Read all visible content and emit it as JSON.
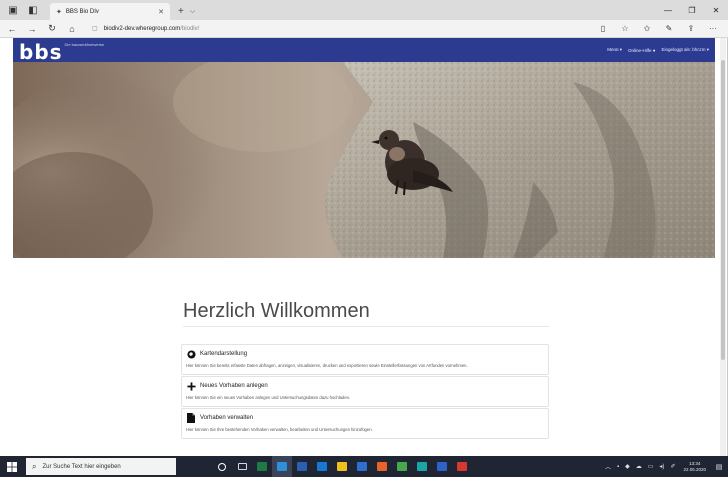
{
  "browser": {
    "tab_title": "BBS Bio DIv",
    "url_host": "biodiv2-dev.wheregroup.com",
    "url_path": "/biodiv/"
  },
  "site": {
    "logo": "bbs",
    "logo_sub": "Die bauwerkfnetwerke",
    "nav": {
      "menu": "Menü ▾",
      "help": "Online-Hilfe ●",
      "login": "Eingeloggt als: bhczm ▾"
    }
  },
  "content": {
    "welcome": "Herzlich Willkommen",
    "cards": [
      {
        "icon": "globe-icon",
        "title": "Kartendarstellung",
        "desc": "Hier können Sie bereits erfasste Daten abfragen, anzeigen, visualisieren, drucken und exportieren sowie Einstellerfassungen von Artfunden vornehmen."
      },
      {
        "icon": "plus-icon",
        "title": "Neues Vorhaben anlegen",
        "desc": "Hier können Sie ein neues Vorhaben anlegen und Untersuchungsdaten dazu hochladen."
      },
      {
        "icon": "document-icon",
        "title": "Vorhaben verwalten",
        "desc": "Hier können Sie Ihre bestehenden Vorhaben verwalten, bearbeiten und Untersuchungen hinzufügen."
      }
    ]
  },
  "taskbar": {
    "search_placeholder": "Zur Suche Text hier eingeben",
    "time": "13:34",
    "date": "22.06.2020",
    "apps": [
      {
        "name": "cortana",
        "color": "#ffffff"
      },
      {
        "name": "task-view",
        "color": "#cfd6e4"
      },
      {
        "name": "excel",
        "color": "#1e7b45"
      },
      {
        "name": "edge",
        "color": "#2f8fd8"
      },
      {
        "name": "word",
        "color": "#2b5fb3"
      },
      {
        "name": "outlook",
        "color": "#1976d2"
      },
      {
        "name": "explorer",
        "color": "#f2c01e"
      },
      {
        "name": "store",
        "color": "#2f6fcf"
      },
      {
        "name": "firefox",
        "color": "#e8622a"
      },
      {
        "name": "app-green",
        "color": "#49a84a"
      },
      {
        "name": "app-teal",
        "color": "#1aa6a6"
      },
      {
        "name": "app-blue",
        "color": "#2d62c8"
      },
      {
        "name": "app-red",
        "color": "#d63a2f"
      }
    ]
  },
  "colors": {
    "brand": "#2c3b8f",
    "taskbar": "#1f2533"
  }
}
